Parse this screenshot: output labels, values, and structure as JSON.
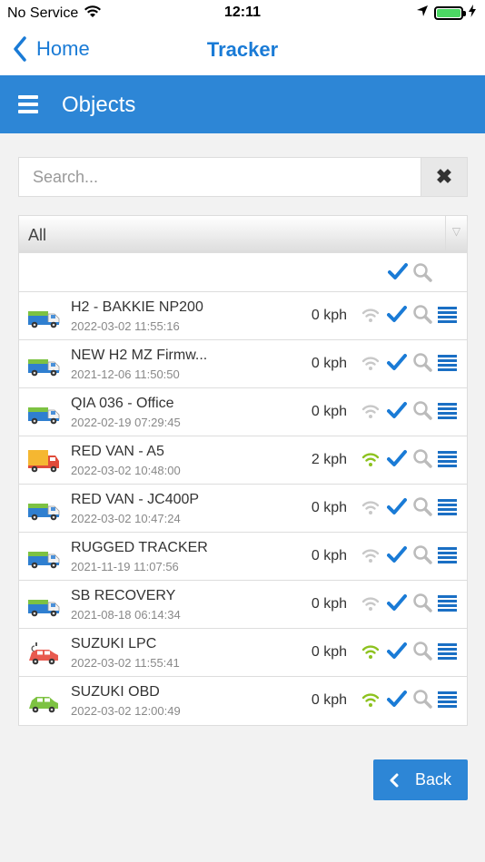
{
  "status_bar": {
    "carrier": "No Service",
    "time": "12:11"
  },
  "nav": {
    "back_label": "Home",
    "title": "Tracker"
  },
  "header": {
    "title": "Objects"
  },
  "search": {
    "placeholder": "Search...",
    "value": ""
  },
  "filter": {
    "selected": "All"
  },
  "colors": {
    "accent": "#2d86d6",
    "check": "#1a7bd6",
    "wifi_active": "#8dc21f",
    "wifi_inactive": "#c8c8c8"
  },
  "objects": [
    {
      "name": "H2 - BAKKIE NP200",
      "date": "2022-03-02 11:55:16",
      "speed": "0 kph",
      "signal": "off",
      "vehicle": "truck-green"
    },
    {
      "name": "NEW H2 MZ Firmw...",
      "date": "2021-12-06 11:50:50",
      "speed": "0 kph",
      "signal": "off",
      "vehicle": "truck-green"
    },
    {
      "name": "QIA 036 - Office",
      "date": "2022-02-19 07:29:45",
      "speed": "0 kph",
      "signal": "off",
      "vehicle": "truck-green"
    },
    {
      "name": "RED VAN - A5",
      "date": "2022-03-02 10:48:00",
      "speed": "2 kph",
      "signal": "on",
      "vehicle": "van-red"
    },
    {
      "name": "RED VAN - JC400P",
      "date": "2022-03-02 10:47:24",
      "speed": "0 kph",
      "signal": "off",
      "vehicle": "truck-green"
    },
    {
      "name": "RUGGED TRACKER",
      "date": "2021-11-19 11:07:56",
      "speed": "0 kph",
      "signal": "off",
      "vehicle": "truck-green"
    },
    {
      "name": "SB RECOVERY",
      "date": "2021-08-18 06:14:34",
      "speed": "0 kph",
      "signal": "off",
      "vehicle": "truck-green"
    },
    {
      "name": "SUZUKI LPC",
      "date": "2022-03-02 11:55:41",
      "speed": "0 kph",
      "signal": "on",
      "vehicle": "car-red-plug"
    },
    {
      "name": "SUZUKI OBD",
      "date": "2022-03-02 12:00:49",
      "speed": "0 kph",
      "signal": "on",
      "vehicle": "car-green"
    }
  ],
  "footer": {
    "back_label": "Back"
  }
}
